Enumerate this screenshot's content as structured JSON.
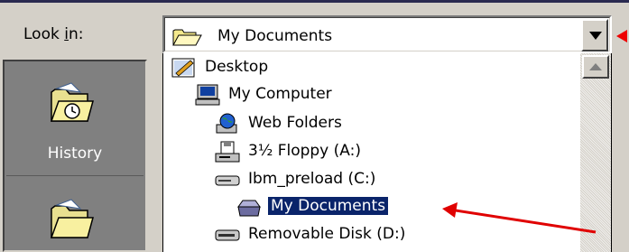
{
  "look_in": {
    "label_prefix": "Look ",
    "label_accel": "i",
    "label_suffix": "n:",
    "selected": "My Documents",
    "selected_icon": "open-folder-icon"
  },
  "places_bar": {
    "items": [
      {
        "label": "History",
        "icon": "history-folder-icon"
      },
      {
        "label": "",
        "icon": "folder-icon"
      }
    ]
  },
  "dropdown": {
    "items": [
      {
        "label": "Desktop",
        "icon": "desktop-icon",
        "selected": false
      },
      {
        "label": "My Computer",
        "icon": "computer-icon",
        "selected": false
      },
      {
        "label": "Web Folders",
        "icon": "web-folders-icon",
        "selected": false
      },
      {
        "label": "3½ Floppy (A:)",
        "icon": "floppy-drive-icon",
        "selected": false
      },
      {
        "label": "Ibm_preload (C:)",
        "icon": "hard-drive-icon",
        "selected": false
      },
      {
        "label": "My Documents",
        "icon": "open-folder-icon",
        "selected": true
      },
      {
        "label": "Removable Disk (D:)",
        "icon": "removable-disk-icon",
        "selected": false
      }
    ]
  },
  "colors": {
    "highlight": "#0a246a",
    "annotation_arrow": "#e00000"
  }
}
